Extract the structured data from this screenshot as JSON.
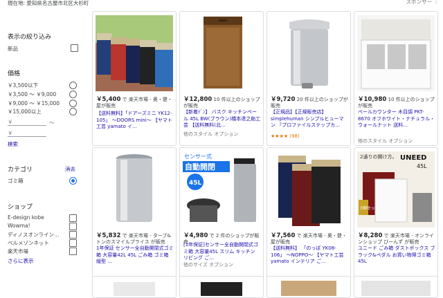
{
  "location": "現在地: 愛知県名古屋市北区大杉町",
  "sponsor": "スポンサー ⋮",
  "sidebar": {
    "filter_title": "表示の絞り込み",
    "new_label": "新品",
    "price_title": "価格",
    "price_options": [
      "￥3,500以下",
      "￥3,500 ～ ￥9,000",
      "￥9,000 ～ ￥15,000",
      "￥15,000以上"
    ],
    "min_placeholder": "￥",
    "max_placeholder": "￥",
    "range_sep": "～",
    "search_label": "検索",
    "category_title": "カテゴリ",
    "clear_label": "消去",
    "category_item": "ゴミ箱",
    "shop_title": "ショップ",
    "shops": [
      "E-design kobe",
      "Wowma!",
      "ディノスオンライン…",
      "ベルメゾンネット",
      "楽天市場"
    ],
    "more_label": "さらに表示"
  },
  "products": [
    {
      "price": "￥5,400",
      "store": " で 楽天市場 - 奥・健・屋が販売",
      "title": "【送料無料】「ドアーズミニ YK12-105」 ～DOORS mini～ 【ヤマト工芸 yamato イ…",
      "meta": ""
    },
    {
      "price": "￥12,800",
      "store": " 10 件以上のショップが販売",
      "title": "【新着ﾃﾞﾝ】 バスク キッチンペール 45L BW(ブラウン)橋本達之助工芸 【送料無料(北…",
      "meta": "他のスタイル オプション"
    },
    {
      "price": "￥9,720",
      "store": " 20 件以上のショップが販売",
      "title": "【正規品】【正規販売店】 simplehuman シンプルヒューマン 『プロファイルステップカ…",
      "meta": "★★★★ (98)"
    },
    {
      "price": "￥10,980",
      "store": " 10 件以上のショップが販売",
      "title": "ペールカウンター 木目調 PKT-8670 オフホワイト・ナチュラル・ウォールナット 送料…",
      "meta": "他のスタイル オプション"
    },
    {
      "price": "￥5,832",
      "store": " で 楽天市場 - ターブ&トンのスマイルプライス が販売",
      "title": "1年保証 センサー全自動開閉式ゴミ箱 大容量42L 45L ごみ箱 ゴミ箱 縦型 …",
      "meta": ""
    },
    {
      "price": "￥4,980",
      "store": " で 2 件のショップが販売",
      "title": "[1年保証]センサー全自動開閉式ゴミ箱 大容量45L スリム キッチン リビング ご…",
      "meta": "他のサイズ オプション"
    },
    {
      "price": "￥7,560",
      "store": " で 楽天市場 - 奥・健・屋が販売",
      "title": "【送料無料】 「のっぽ YK08-106」 ～NOPPO～ 【ヤマト工芸 yamato インテリア ご…",
      "meta": ""
    },
    {
      "price": "￥8,280",
      "store": " で 楽天市場 - オンラインショップ びーんず が販売",
      "title": "ユニード ごみ箱 ダストボックス ブラック&ペダル お買い物得ゴミ箱 45L",
      "meta": ""
    }
  ],
  "image_text": {
    "sensor": "センサー式",
    "auto": "自動開閉",
    "size45": "45L",
    "brand": "UNEED",
    "brand45": "45L",
    "twoway": "2通りの開け方。",
    "set": "3個セット"
  }
}
